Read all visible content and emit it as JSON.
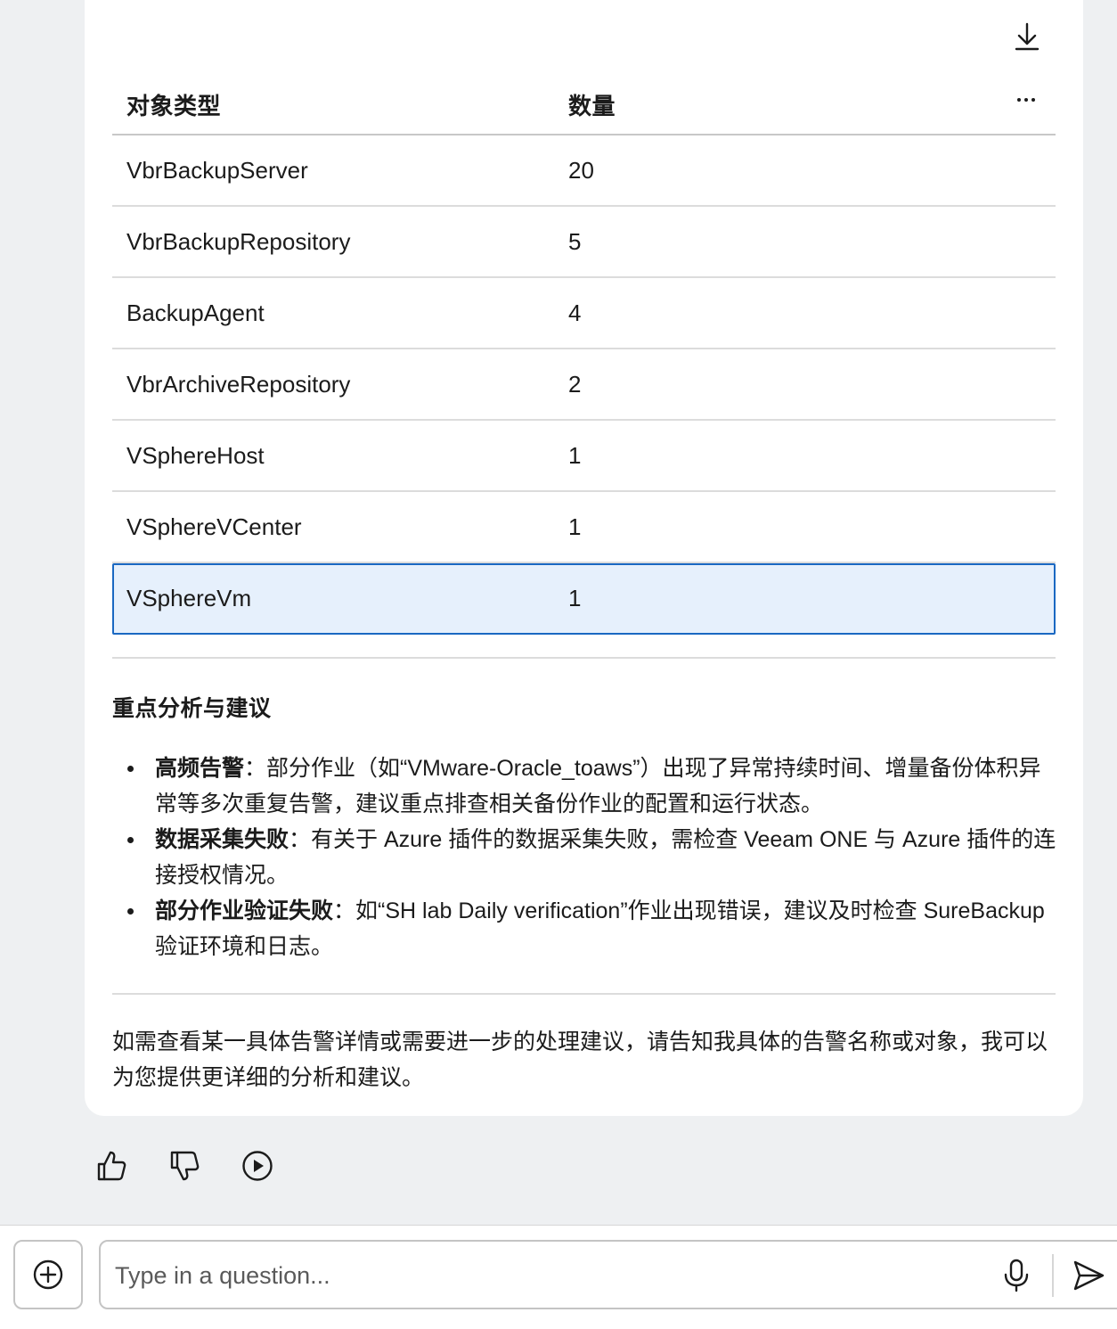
{
  "table": {
    "headers": {
      "type": "对象类型",
      "count": "数量"
    },
    "rows": [
      {
        "type": "VbrBackupServer",
        "count": "20"
      },
      {
        "type": "VbrBackupRepository",
        "count": "5"
      },
      {
        "type": "BackupAgent",
        "count": "4"
      },
      {
        "type": "VbrArchiveRepository",
        "count": "2"
      },
      {
        "type": "VSphereHost",
        "count": "1"
      },
      {
        "type": "VSphereVCenter",
        "count": "1"
      },
      {
        "type": "VSphereVm",
        "count": "1"
      }
    ],
    "selected_row": 6
  },
  "analysis": {
    "title": "重点分析与建议",
    "items": [
      {
        "label": "高频告警",
        "text": "：部分作业（如“VMware-Oracle_toaws”）出现了异常持续时间、增量备份体积异常等多次重复告警，建议重点排查相关备份作业的配置和运行状态。"
      },
      {
        "label": "数据采集失败",
        "text": "：有关于 Azure 插件的数据采集失败，需检查 Veeam ONE 与 Azure 插件的连接授权情况。"
      },
      {
        "label": "部分作业验证失败",
        "text": "：如“SH lab Daily verification”作业出现错误，建议及时检查 SureBackup 验证环境和日志。"
      }
    ],
    "closing": "如需查看某一具体告警详情或需要进一步的处理建议，请告知我具体的告警名称或对象，我可以为您提供更详细的分析和建议。"
  },
  "composer": {
    "placeholder": "Type in a question..."
  },
  "icons": {
    "download": "download-icon",
    "more": "more-icon",
    "thumbs_up": "thumbs-up-icon",
    "thumbs_down": "thumbs-down-icon",
    "play": "play-icon",
    "add": "plus-circle-icon",
    "mic": "microphone-icon",
    "send": "send-icon"
  },
  "colors": {
    "selected_row_bg": "#e6f0fc",
    "selected_row_border": "#1a68c2",
    "page_bg": "#eef0f2"
  }
}
